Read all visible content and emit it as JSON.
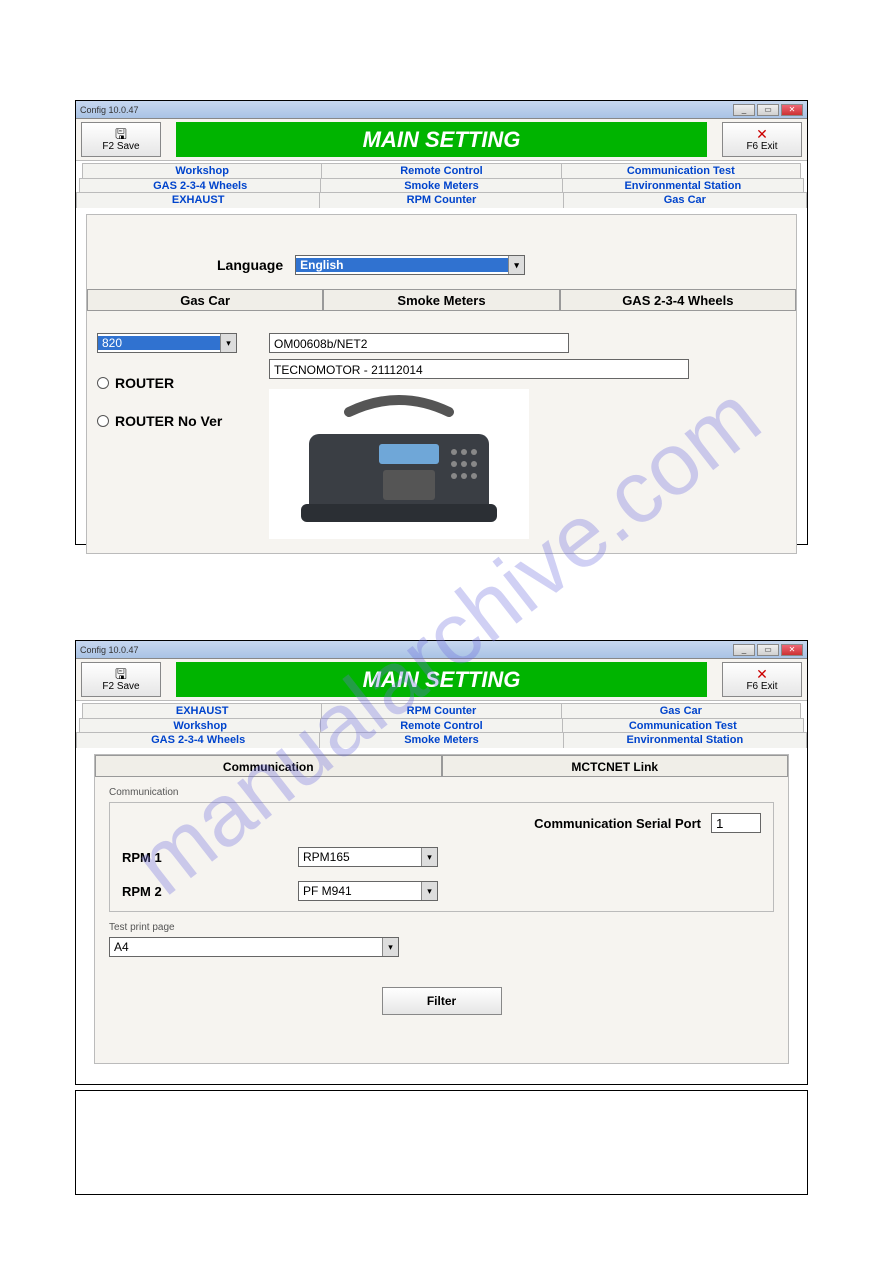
{
  "watermark": "manualarchive.com",
  "window": {
    "title": "Config 10.0.47"
  },
  "toolbar": {
    "save_label": "F2 Save",
    "exit_label": "F6 Exit"
  },
  "title_banner": "MAIN SETTING",
  "frame1": {
    "tabs_row1": [
      "Workshop",
      "Remote Control",
      "Communication Test"
    ],
    "tabs_row2": [
      "GAS 2-3-4 Wheels",
      "Smoke Meters",
      "Environmental Station"
    ],
    "tabs_row3": [
      "EXHAUST",
      "RPM Counter",
      "Gas Car"
    ],
    "language_label": "Language",
    "language_value": "English",
    "subtabs": [
      "Gas Car",
      "Smoke Meters",
      "GAS 2-3-4 Wheels"
    ],
    "model_combo": "820",
    "router_label": "ROUTER",
    "router_nover_label": "ROUTER No Ver",
    "device_code": "OM00608b/NET2",
    "device_info": "TECNOMOTOR - 21112014"
  },
  "frame2": {
    "tabs_row1": [
      "EXHAUST",
      "RPM Counter",
      "Gas Car"
    ],
    "tabs_row2": [
      "Workshop",
      "Remote Control",
      "Communication Test"
    ],
    "tabs_row3": [
      "GAS 2-3-4 Wheels",
      "Smoke Meters",
      "Environmental Station"
    ],
    "inner_tabs": [
      "Communication",
      "MCTCNET Link"
    ],
    "group_comm_label": "Communication",
    "csp_label": "Communication Serial Port",
    "csp_value": "1",
    "rpm1_label": "RPM 1",
    "rpm1_value": "RPM165",
    "rpm2_label": "RPM 2",
    "rpm2_value": "PF M941",
    "test_print_label": "Test print page",
    "test_print_value": "A4",
    "filter_label": "Filter"
  }
}
